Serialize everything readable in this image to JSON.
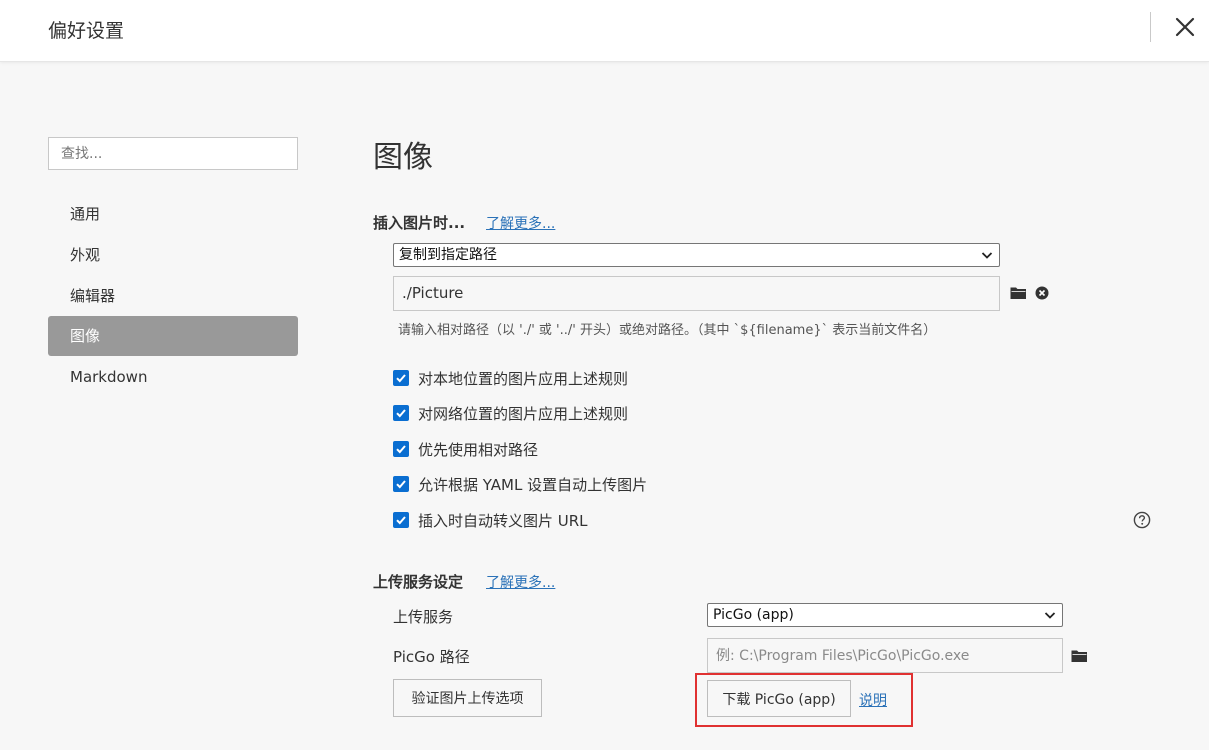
{
  "window": {
    "title": "偏好设置",
    "close_icon": "close-icon"
  },
  "sidebar": {
    "search_placeholder": "查找...",
    "items": [
      {
        "label": "通用",
        "active": false
      },
      {
        "label": "外观",
        "active": false
      },
      {
        "label": "编辑器",
        "active": false
      },
      {
        "label": "图像",
        "active": true
      },
      {
        "label": "Markdown",
        "active": false
      }
    ]
  },
  "main": {
    "title": "图像",
    "insert_section": {
      "title": "插入图片时...",
      "learn_more": "了解更多...",
      "action_select": "复制到指定路径",
      "path_value": "./Picture",
      "path_hint": "请输入相对路径（以 './' 或 '../' 开头）或绝对路径。（其中 `${filename}` 表示当前文件名）",
      "checkboxes": [
        {
          "label": "对本地位置的图片应用上述规则",
          "checked": true
        },
        {
          "label": "对网络位置的图片应用上述规则",
          "checked": true
        },
        {
          "label": "优先使用相对路径",
          "checked": true
        },
        {
          "label": "允许根据 YAML 设置自动上传图片",
          "checked": true
        },
        {
          "label": "插入时自动转义图片 URL",
          "checked": true
        }
      ]
    },
    "upload_section": {
      "title": "上传服务设定",
      "learn_more": "了解更多...",
      "service_label": "上传服务",
      "service_value": "PicGo (app)",
      "path_label": "PicGo 路径",
      "path_placeholder": "例: C:\\Program Files\\PicGo\\PicGo.exe",
      "verify_button": "验证图片上传选项",
      "download_button": "下载 PicGo (app)",
      "help_link": "说明"
    }
  },
  "colors": {
    "accent": "#0a6ed1",
    "link": "#2b72b8",
    "active_nav_bg": "#999999",
    "highlight": "#e03131"
  }
}
